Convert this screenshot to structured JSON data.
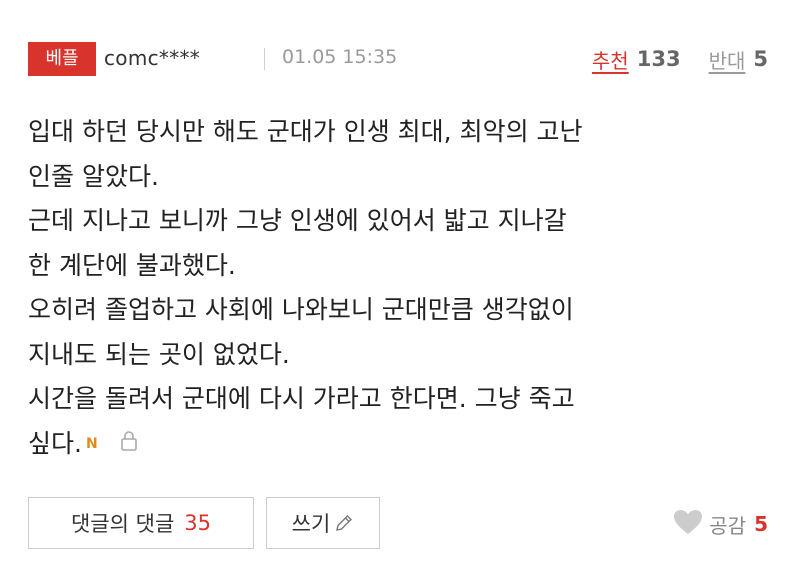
{
  "comment": {
    "badge": "베플",
    "username": "comc****",
    "timestamp": "01.05 15:35",
    "upvote_label": "추천",
    "upvote_count": "133",
    "downvote_label": "반대",
    "downvote_count": "5",
    "body_lines": [
      "입대 하던 당시만 해도 군대가 인생 최대, 최악의 고난",
      "인줄 알았다.",
      "근데 지나고 보니까 그냥 인생에 있어서 밟고 지나갈",
      "한 계단에 불과했다.",
      "오히려 졸업하고 사회에 나와보니 군대만큼 생각없이",
      "지내도 되는 곳이 없었다.",
      "시간을 돌려서 군대에 다시 가라고 한다면. 그냥 죽고",
      "싶다."
    ],
    "new_mark": "N"
  },
  "actions": {
    "replies_label": "댓글의 댓글",
    "replies_count": "35",
    "write_label": "쓰기",
    "empathy_label": "공감",
    "empathy_count": "5"
  },
  "colors": {
    "accent": "#d8342c",
    "muted": "#9a9a9a",
    "new_mark": "#e08c1a"
  },
  "icons": [
    "new-mark-icon",
    "lock-icon",
    "pencil-icon",
    "heart-icon"
  ]
}
